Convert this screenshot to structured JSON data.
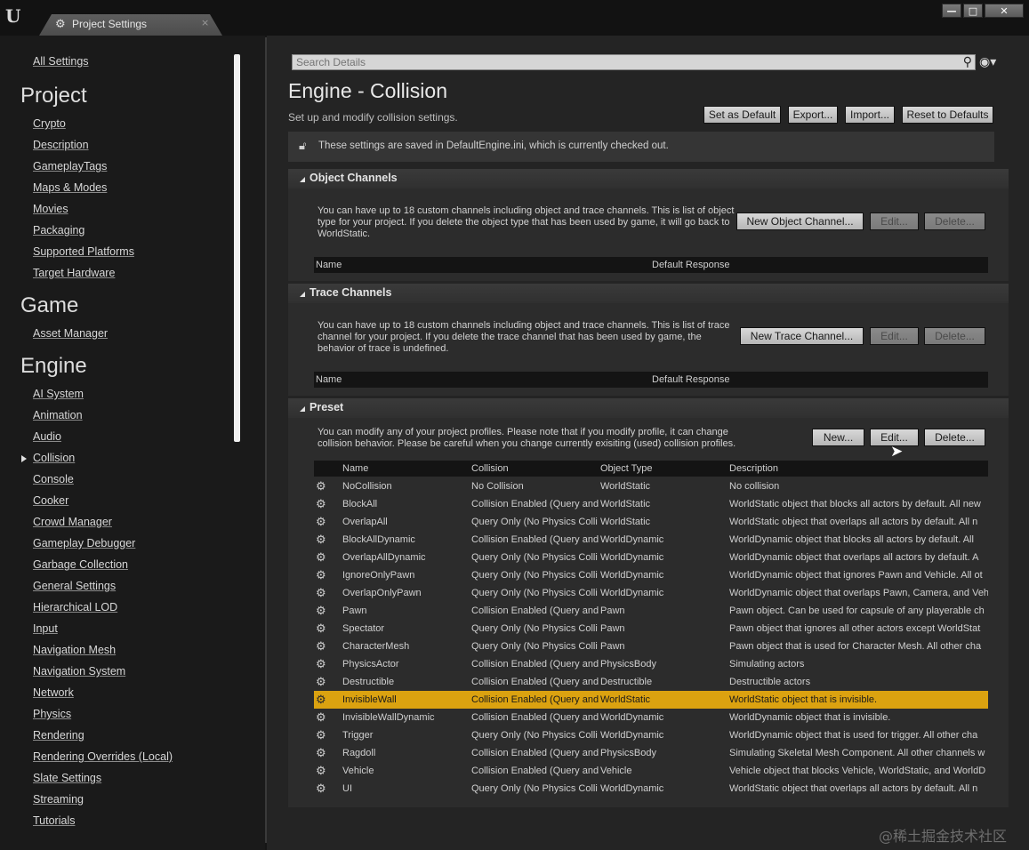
{
  "window": {
    "tab_title": "Project Settings",
    "logo": "U",
    "tab_close": "×",
    "minimize": "—",
    "maximize": "□",
    "close": "✕"
  },
  "sidebar": {
    "all_settings": "All Settings",
    "project_heading": "Project",
    "project_items": [
      "Crypto",
      "Description",
      "GameplayTags",
      "Maps & Modes",
      "Movies",
      "Packaging",
      "Supported Platforms",
      "Target Hardware"
    ],
    "game_heading": "Game",
    "game_items": [
      "Asset Manager"
    ],
    "engine_heading": "Engine",
    "engine_items": [
      "AI System",
      "Animation",
      "Audio",
      "Collision",
      "Console",
      "Cooker",
      "Crowd Manager",
      "Gameplay Debugger",
      "Garbage Collection",
      "General Settings",
      "Hierarchical LOD",
      "Input",
      "Navigation Mesh",
      "Navigation System",
      "Network",
      "Physics",
      "Rendering",
      "Rendering Overrides (Local)",
      "Slate Settings",
      "Streaming",
      "Tutorials"
    ],
    "selected_item": "Collision"
  },
  "search": {
    "placeholder": "Search Details"
  },
  "header": {
    "title": "Engine - Collision",
    "subtitle": "Set up and modify collision settings.",
    "buttons": {
      "set_default": "Set as Default",
      "export": "Export...",
      "import": "Import...",
      "reset": "Reset to Defaults"
    }
  },
  "notice": "These settings are saved in DefaultEngine.ini, which is currently checked out.",
  "object_channels": {
    "title": "Object Channels",
    "description": "You can have up to 18 custom channels including object and trace channels. This is list of object type for your project. If you delete the object type that has been used by game, it will go back to WorldStatic.",
    "new_button": "New Object Channel...",
    "edit_button": "Edit...",
    "delete_button": "Delete...",
    "columns": [
      "Name",
      "Default Response"
    ]
  },
  "trace_channels": {
    "title": "Trace Channels",
    "description": "You can have up to 18 custom channels including object and trace channels. This is list of trace channel for your project. If you delete the trace channel that has been used by game, the behavior of trace is undefined.",
    "new_button": "New Trace Channel...",
    "edit_button": "Edit...",
    "delete_button": "Delete...",
    "columns": [
      "Name",
      "Default Response"
    ]
  },
  "preset": {
    "title": "Preset",
    "description": "You can modify any of your project profiles. Please note that if you modify profile, it can change collision behavior. Please be careful when you change currently exisiting (used) collision profiles.",
    "new_button": "New...",
    "edit_button": "Edit...",
    "delete_button": "Delete...",
    "columns": [
      "Name",
      "Collision",
      "Object Type",
      "Description"
    ],
    "selected_row": "InvisibleWall",
    "rows": [
      [
        "NoCollision",
        "No Collision",
        "WorldStatic",
        "No collision"
      ],
      [
        "BlockAll",
        "Collision Enabled (Query and",
        "WorldStatic",
        "WorldStatic object that blocks all actors by default. All new"
      ],
      [
        "OverlapAll",
        "Query Only (No Physics Colli",
        "WorldStatic",
        "WorldStatic object that overlaps all actors by default. All n"
      ],
      [
        "BlockAllDynamic",
        "Collision Enabled (Query and",
        "WorldDynamic",
        "WorldDynamic object that blocks all actors by default. All"
      ],
      [
        "OverlapAllDynamic",
        "Query Only (No Physics Colli",
        "WorldDynamic",
        "WorldDynamic object that overlaps all actors by default. A"
      ],
      [
        "IgnoreOnlyPawn",
        "Query Only (No Physics Colli",
        "WorldDynamic",
        "WorldDynamic object that ignores Pawn and Vehicle. All ot"
      ],
      [
        "OverlapOnlyPawn",
        "Query Only (No Physics Colli",
        "WorldDynamic",
        "WorldDynamic object that overlaps Pawn, Camera, and Veh"
      ],
      [
        "Pawn",
        "Collision Enabled (Query and",
        "Pawn",
        "Pawn object. Can be used for capsule of any playerable ch"
      ],
      [
        "Spectator",
        "Query Only (No Physics Colli",
        "Pawn",
        "Pawn object that ignores all other actors except WorldStat"
      ],
      [
        "CharacterMesh",
        "Query Only (No Physics Colli",
        "Pawn",
        "Pawn object that is used for Character Mesh. All other cha"
      ],
      [
        "PhysicsActor",
        "Collision Enabled (Query and",
        "PhysicsBody",
        "Simulating actors"
      ],
      [
        "Destructible",
        "Collision Enabled (Query and",
        "Destructible",
        "Destructible actors"
      ],
      [
        "InvisibleWall",
        "Collision Enabled (Query and",
        "WorldStatic",
        "WorldStatic object that is invisible."
      ],
      [
        "InvisibleWallDynamic",
        "Collision Enabled (Query and",
        "WorldDynamic",
        "WorldDynamic object that is invisible."
      ],
      [
        "Trigger",
        "Query Only (No Physics Colli",
        "WorldDynamic",
        "WorldDynamic object that is used for trigger. All other cha"
      ],
      [
        "Ragdoll",
        "Collision Enabled (Query and",
        "PhysicsBody",
        "Simulating Skeletal Mesh Component. All other channels w"
      ],
      [
        "Vehicle",
        "Collision Enabled (Query and",
        "Vehicle",
        "Vehicle object that blocks Vehicle, WorldStatic, and WorldD"
      ],
      [
        "UI",
        "Query Only (No Physics Colli",
        "WorldDynamic",
        "WorldStatic object that overlaps all actors by default. All n"
      ]
    ]
  },
  "icons": {
    "row": "gear-icon",
    "search": "search-icon",
    "visibility": "eye-icon",
    "lock": "lock-icon"
  },
  "colors": {
    "selection": "#dba210",
    "background": "#242424"
  },
  "watermark": "@稀土掘金技术社区"
}
